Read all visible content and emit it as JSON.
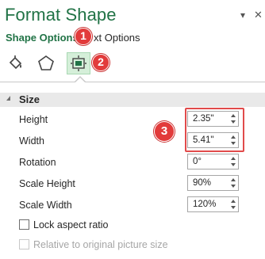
{
  "pane": {
    "title": "Format Shape",
    "dropdown_glyph": "▾",
    "close_glyph": "✕"
  },
  "tabs": {
    "shape_options": "Shape Options",
    "text_options_visible": "xt Options"
  },
  "icons": {
    "fill_line": "fill-line-icon",
    "effects": "effects-pentagon-icon",
    "size_properties": "size-properties-icon"
  },
  "callouts": {
    "one": "1",
    "two": "2",
    "three": "3"
  },
  "section": {
    "title": "Size"
  },
  "fields": {
    "height": {
      "label": "Height",
      "value": "2.35\""
    },
    "width": {
      "label": "Width",
      "value": "5.41\""
    },
    "rotation": {
      "label": "Rotation",
      "value": "0°"
    },
    "scale_height": {
      "label": "Scale Height",
      "value": "90%"
    },
    "scale_width": {
      "label": "Scale Width",
      "value": "120%"
    }
  },
  "checkboxes": {
    "lock_aspect": {
      "label": "Lock aspect ratio",
      "checked": false
    },
    "relative_original": {
      "label": "Relative to original picture size",
      "checked": false,
      "disabled": true
    }
  },
  "colors": {
    "accent": "#217346",
    "callout": "#e23b3b",
    "highlight": "#e14b4b",
    "selected_icon_bg": "#d5efd9",
    "section_bg": "#e9e9e9"
  }
}
